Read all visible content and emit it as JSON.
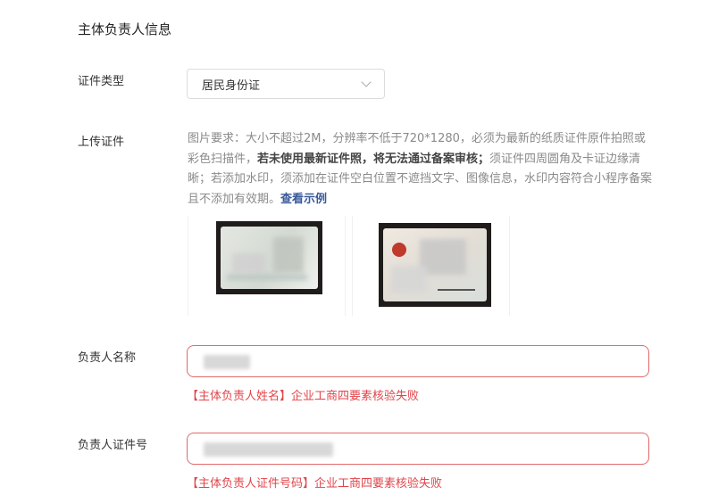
{
  "section": {
    "title": "主体负责人信息"
  },
  "id_type": {
    "label": "证件类型",
    "selected": "居民身份证"
  },
  "upload": {
    "label": "上传证件",
    "desc_part1": "图片要求：大小不超过2M，分辨率不低于720*1280，必须为最新的纸质证件原件拍照或彩色扫描件，",
    "desc_bold": "若未使用最新证件照，将无法通过备案审核；",
    "desc_part2": "须证件四周圆角及卡证边缘清晰；若添加水印，须添加在证件空白位置不遮挡文字、图像信息，水印内容符合小程序备案且不添加有效期。",
    "example_link": "查看示例",
    "front_sample_icon": "id-card-front-image",
    "back_sample_icon": "id-card-back-image"
  },
  "name_field": {
    "label": "负责人名称",
    "error": "【主体负责人姓名】企业工商四要素核验失败"
  },
  "id_number_field": {
    "label": "负责人证件号",
    "error": "【主体负责人证件号码】企业工商四要素核验失败"
  },
  "colors": {
    "error": "#e0454a",
    "error_border": "#e06a6a",
    "link": "#3a5a9b"
  }
}
